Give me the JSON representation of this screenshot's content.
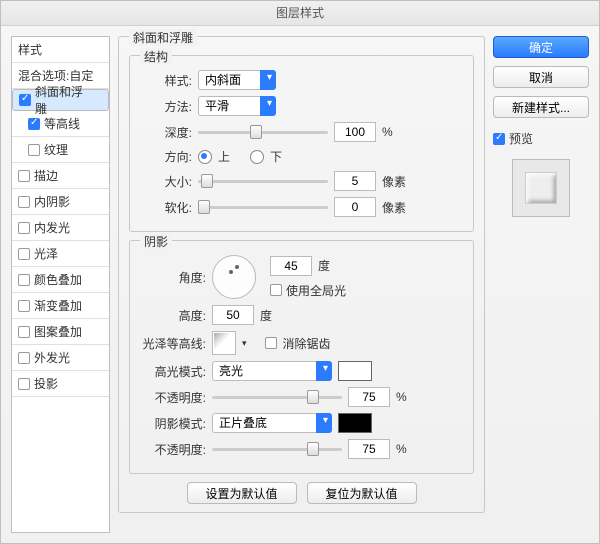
{
  "title": "图层样式",
  "sidebar": {
    "head": "样式",
    "blend": "混合选项:自定",
    "items": [
      {
        "label": "斜面和浮雕",
        "on": true,
        "sel": true
      },
      {
        "label": "等高线",
        "on": true,
        "indent": true
      },
      {
        "label": "纹理",
        "on": false,
        "indent": true
      },
      {
        "label": "描边",
        "on": false
      },
      {
        "label": "内阴影",
        "on": false
      },
      {
        "label": "内发光",
        "on": false
      },
      {
        "label": "光泽",
        "on": false
      },
      {
        "label": "颜色叠加",
        "on": false
      },
      {
        "label": "渐变叠加",
        "on": false
      },
      {
        "label": "图案叠加",
        "on": false
      },
      {
        "label": "外发光",
        "on": false
      },
      {
        "label": "投影",
        "on": false
      }
    ]
  },
  "panel_title": "斜面和浮雕",
  "structure": {
    "title": "结构",
    "style_label": "样式:",
    "style_value": "内斜面",
    "method_label": "方法:",
    "method_value": "平滑",
    "depth_label": "深度:",
    "depth_value": "100",
    "depth_unit": "%",
    "dir_label": "方向:",
    "dir_up": "上",
    "dir_down": "下",
    "size_label": "大小:",
    "size_value": "5",
    "size_unit": "像素",
    "soften_label": "软化:",
    "soften_value": "0",
    "soften_unit": "像素"
  },
  "shading": {
    "title": "阴影",
    "angle_label": "角度:",
    "angle_value": "45",
    "deg": "度",
    "global": "使用全局光",
    "alt_label": "高度:",
    "alt_value": "50",
    "gloss_label": "光泽等高线:",
    "anti": "消除锯齿",
    "hl_mode_label": "高光模式:",
    "hl_mode_value": "亮光",
    "hl_color": "#ffffff",
    "hl_op_label": "不透明度:",
    "hl_op_value": "75",
    "pct": "%",
    "sh_mode_label": "阴影模式:",
    "sh_mode_value": "正片叠底",
    "sh_color": "#000000",
    "sh_op_label": "不透明度:",
    "sh_op_value": "75"
  },
  "footer": {
    "defaults": "设置为默认值",
    "reset": "复位为默认值"
  },
  "right": {
    "ok": "确定",
    "cancel": "取消",
    "newstyle": "新建样式...",
    "preview": "预览"
  }
}
